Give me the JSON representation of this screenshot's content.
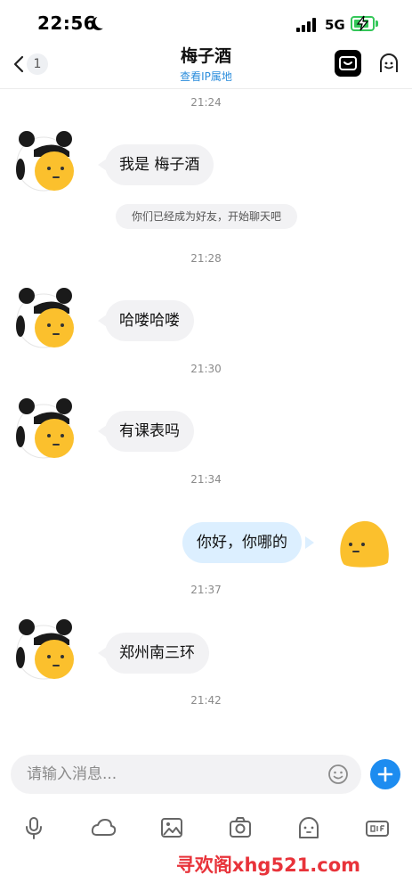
{
  "status_bar": {
    "time": "22:56",
    "network": "5G"
  },
  "header": {
    "back_badge": "1",
    "title": "梅子酒",
    "subtitle": "查看IP属地"
  },
  "messages": {
    "ts1": "21:24",
    "m1": "我是 梅子酒",
    "system_note": "你们已经成为好友，开始聊天吧",
    "ts2": "21:28",
    "m2": "哈喽哈喽",
    "ts3": "21:30",
    "m3": "有课表吗",
    "ts4": "21:34",
    "m4": "你好，你哪的",
    "ts5": "21:37",
    "m5": "郑州南三环",
    "ts6": "21:42"
  },
  "input": {
    "placeholder": "请输入消息..."
  },
  "toolbar": [
    "microphone-icon",
    "cloud-icon",
    "image-icon",
    "camera-icon",
    "sticker-icon",
    "gif-icon"
  ],
  "watermark": "寻欢阁xhg521.com",
  "colors": {
    "accent": "#1d8cf0",
    "outgoing_bubble": "#dcefff",
    "incoming_bubble": "#f2f2f4",
    "subtitle": "#2b8ddc",
    "watermark": "#e8333a"
  }
}
